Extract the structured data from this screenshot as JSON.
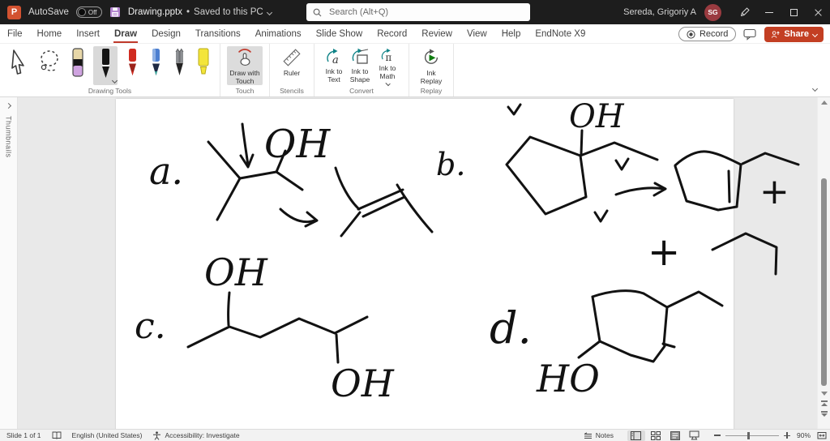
{
  "title_bar": {
    "logo_letter": "P",
    "autosave_label": "AutoSave",
    "autosave_state": "Off",
    "file_name": "Drawing.pptx",
    "bullet": "•",
    "file_status": "Saved to this PC",
    "search_placeholder": "Search (Alt+Q)",
    "user_name": "Sereda, Grigoriy A",
    "user_initials": "SG"
  },
  "ribbon": {
    "tabs": [
      "File",
      "Home",
      "Insert",
      "Draw",
      "Design",
      "Transitions",
      "Animations",
      "Slide Show",
      "Record",
      "Review",
      "View",
      "Help",
      "EndNote X9"
    ],
    "active_tab": "Draw",
    "record_button_label": "Record",
    "share_button_label": "Share",
    "groups": {
      "drawing_tools_label": "Drawing Tools",
      "touch_label": "Touch",
      "draw_with_touch_label": "Draw with Touch",
      "stencils_label": "Stencils",
      "ruler_label": "Ruler",
      "convert_label": "Convert",
      "ink_to_text_label": "Ink to Text",
      "ink_to_shape_label": "Ink to Shape",
      "ink_to_math_label": "Ink to Math",
      "replay_label": "Replay",
      "ink_replay_label": "Ink Replay"
    }
  },
  "thumbnails_panel": {
    "label": "Thumbnails"
  },
  "slide_ink": {
    "item_a_label": "a.",
    "item_b_label": "b.",
    "item_c_label": "c.",
    "item_d_label": "d.",
    "oh_a": "OH",
    "oh_b": "OH",
    "oh_c_top": "OH",
    "oh_c_bottom": "OH",
    "ho_d": "HO",
    "plus_top": "+",
    "plus_bottom": "+"
  },
  "status_bar": {
    "slide_counter": "Slide 1 of 1",
    "language": "English (United States)",
    "accessibility": "Accessibility: Investigate",
    "notes_label": "Notes",
    "zoom_level": "90%"
  },
  "colors": {
    "accent_red": "#c0392b",
    "share_button_red": "#c33f23",
    "avatar_maroon": "#9a3b40",
    "convert_teal": "#0f8387",
    "replay_green": "#107c10",
    "ink_black": "#121212"
  }
}
